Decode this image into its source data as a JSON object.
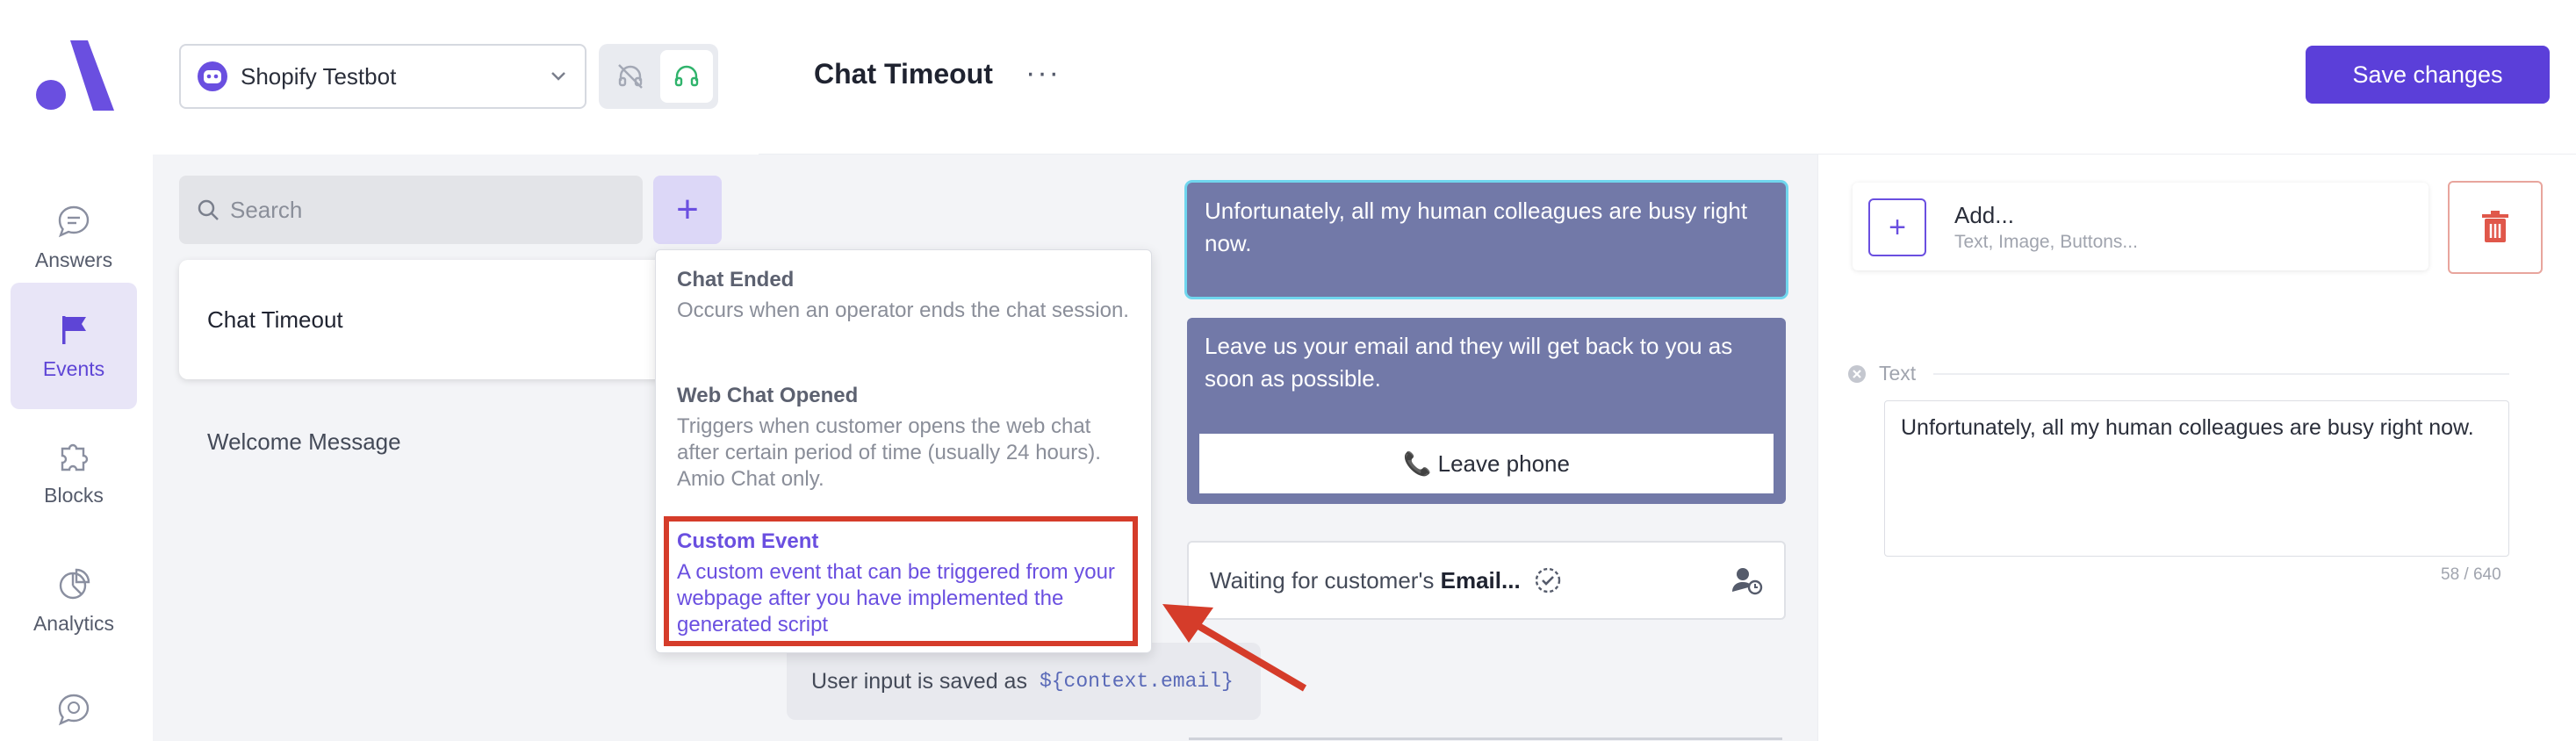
{
  "sidebar": {
    "items": [
      {
        "label": "Answers",
        "icon": "chat-bubble-icon"
      },
      {
        "label": "Events",
        "icon": "flag-icon",
        "active": true
      },
      {
        "label": "Blocks",
        "icon": "puzzle-icon"
      },
      {
        "label": "Analytics",
        "icon": "pie-chart-icon"
      },
      {
        "label": "",
        "icon": "history-icon"
      }
    ]
  },
  "bot_selector": {
    "name": "Shopify Testbot"
  },
  "search": {
    "placeholder": "Search"
  },
  "events": [
    {
      "label": "Chat Timeout",
      "selected": true
    },
    {
      "label": "Welcome Message"
    }
  ],
  "header": {
    "title": "Chat Timeout",
    "more": "···",
    "save_label": "Save changes"
  },
  "dropdown": {
    "items": [
      {
        "title": "Chat Ended",
        "desc": "Occurs when an operator ends the chat session."
      },
      {
        "title": "Web Chat Opened",
        "desc": "Triggers when customer opens the web chat after certain period of time (usually 24 hours). Amio Chat only."
      },
      {
        "title": "Custom Event",
        "desc": "A custom event that can be triggered from your webpage after you have implemented the generated script"
      }
    ]
  },
  "flow": {
    "message1": "Unfortunately, all my human colleagues are busy right now.",
    "message2": "Leave us your email and they will get back to you as soon as possible.",
    "button_label": "📞 Leave phone",
    "waiting_prefix": "Waiting for customer's",
    "waiting_bold": "Email...",
    "saved_prefix": "User input is saved as",
    "saved_var": "${context.email}"
  },
  "right_panel": {
    "add_title": "Add...",
    "add_sub": "Text, Image, Buttons...",
    "text_label": "Text",
    "text_value": "Unfortunately, all my human colleagues are busy right now.",
    "counter": "58 / 640"
  },
  "colors": {
    "accent": "#5b3fd9",
    "bubble": "#7279a8",
    "highlight": "#d53c2a",
    "selection": "#70d6ee"
  }
}
